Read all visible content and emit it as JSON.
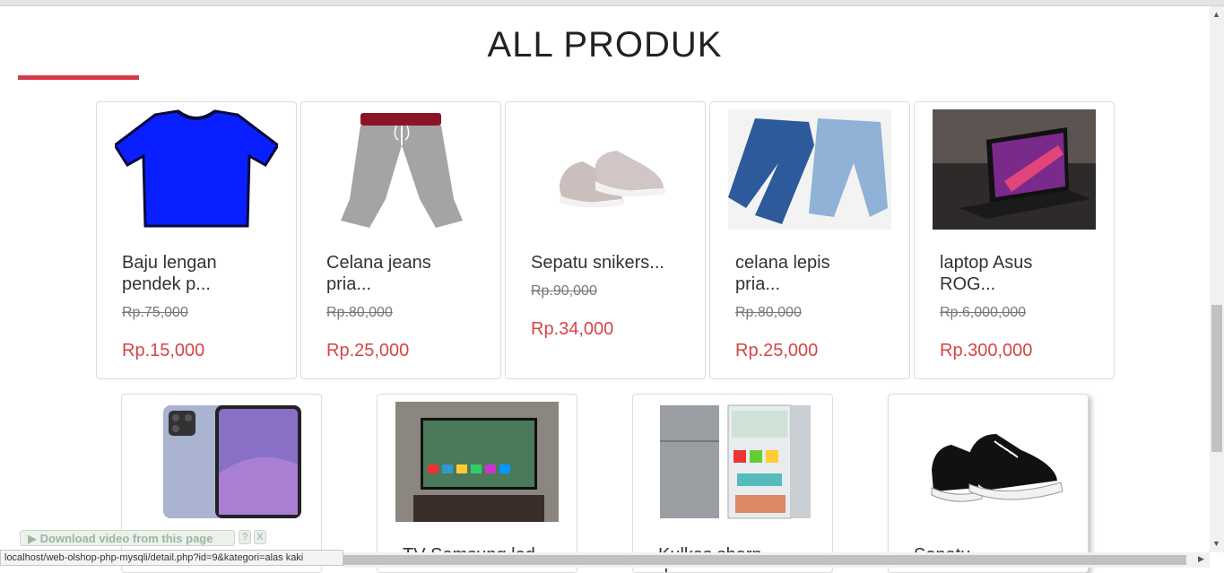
{
  "page": {
    "heading": "ALL PRODUK"
  },
  "row1": [
    {
      "name_line1": "Baju lengan",
      "name_line2": "pendek p...",
      "old_price": "Rp.75,000",
      "price": "Rp.15,000",
      "image": "blue-tshirt"
    },
    {
      "name_line1": "Celana jeans",
      "name_line2": "pria...",
      "old_price": "Rp.80,000",
      "price": "Rp.25,000",
      "image": "grey-jogger-pants"
    },
    {
      "name_line1": "Sepatu snikers...",
      "name_line2": "",
      "old_price": "Rp.90,000",
      "price": "Rp.34,000",
      "image": "grey-sneakers"
    },
    {
      "name_line1": "celana lepis",
      "name_line2": "pria...",
      "old_price": "Rp.80,000",
      "price": "Rp.25,000",
      "image": "blue-jeans"
    },
    {
      "name_line1": "laptop Asus",
      "name_line2": "ROG...",
      "old_price": "Rp.6,000,000",
      "price": "Rp.300,000",
      "image": "laptop"
    }
  ],
  "row2": [
    {
      "name": "",
      "image": "smartphone"
    },
    {
      "name": "TV Samsung led...",
      "image": "television"
    },
    {
      "name": "Kulkas sharp dua...",
      "image": "refrigerator"
    },
    {
      "name": "Sepatu...",
      "image": "black-converse-shoe"
    }
  ],
  "overlay": {
    "download_label": "Download video from this page",
    "help": "?",
    "close": "X"
  },
  "statusbar": {
    "url": "localhost/web-olshop-php-mysqli/detail.php?id=9&kategori=alas kaki"
  },
  "colors": {
    "accent": "#d63a4a",
    "price": "#d64545"
  }
}
